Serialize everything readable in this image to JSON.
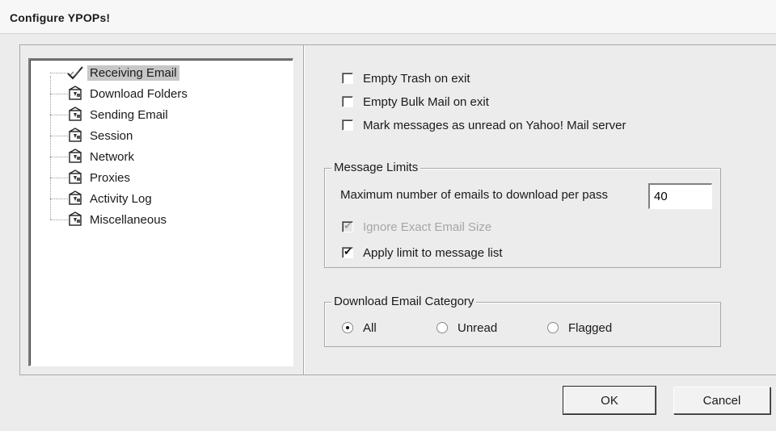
{
  "window": {
    "title": "Configure YPOPs!"
  },
  "tree": {
    "items": [
      {
        "label": "Receiving Email",
        "icon": "checkmark-icon",
        "selected": true
      },
      {
        "label": "Download Folders",
        "icon": "settings-box-icon"
      },
      {
        "label": "Sending Email",
        "icon": "settings-box-icon"
      },
      {
        "label": "Session",
        "icon": "settings-box-icon"
      },
      {
        "label": "Network",
        "icon": "settings-box-icon"
      },
      {
        "label": "Proxies",
        "icon": "settings-box-icon"
      },
      {
        "label": "Activity Log",
        "icon": "settings-box-icon"
      },
      {
        "label": "Miscellaneous",
        "icon": "settings-box-icon"
      }
    ]
  },
  "options": {
    "empty_trash": {
      "label": "Empty Trash on exit",
      "checked": false
    },
    "empty_bulk": {
      "label": "Empty Bulk Mail on exit",
      "checked": false
    },
    "mark_unread": {
      "label": "Mark messages as unread on Yahoo! Mail server",
      "checked": false
    }
  },
  "message_limits": {
    "legend": "Message Limits",
    "max_label": "Maximum number of emails to download per pass",
    "max_value": "40",
    "ignore_size": {
      "label": "Ignore Exact Email Size",
      "checked": true,
      "disabled": true
    },
    "apply_limit": {
      "label": "Apply limit to message list",
      "checked": true
    }
  },
  "download_category": {
    "legend": "Download Email Category",
    "options": [
      {
        "label": "All",
        "selected": true
      },
      {
        "label": "Unread",
        "selected": false
      },
      {
        "label": "Flagged",
        "selected": false
      }
    ]
  },
  "buttons": {
    "ok": "OK",
    "cancel": "Cancel"
  }
}
